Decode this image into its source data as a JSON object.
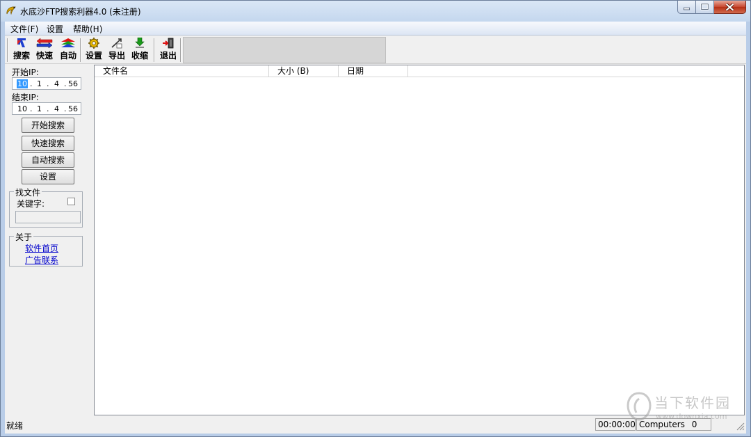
{
  "window": {
    "title": "水底沙FTP搜索利器4.0 (未注册)"
  },
  "menu": {
    "items": [
      "文件(F)",
      "设置",
      "帮助(H)"
    ]
  },
  "toolbar": {
    "search": "搜索",
    "quick": "快速",
    "auto": "自动",
    "settings": "设置",
    "export": "导出",
    "collapse": "收缩",
    "exit": "退出"
  },
  "left_panel": {
    "start_ip_label": "开始IP:",
    "start_ip": [
      "10",
      "1",
      "4",
      "56"
    ],
    "end_ip_label": "结束IP:",
    "end_ip": [
      "10",
      "1",
      "4",
      "56"
    ],
    "btn_start_search": "开始搜索",
    "btn_quick_search": "快速搜索",
    "btn_auto_search": "自动搜索",
    "btn_settings": "设置",
    "find_group_title": "找文件",
    "keyword_label": "关键字:",
    "keyword_value": "",
    "about_group_title": "关于",
    "link_home": "软件首页",
    "link_ads": "广告联系"
  },
  "list": {
    "columns": [
      "文件名",
      "大小 (B)",
      "日期"
    ],
    "rows": []
  },
  "status": {
    "text": "就绪",
    "time": "00:00:00",
    "computers_label": "Computers",
    "computers_count": "0"
  },
  "watermark": {
    "text": "当下软件园",
    "url": "www.downxia.com"
  },
  "colors": {
    "selection": "#3399ff",
    "link": "#0000cc",
    "close_button": "#c7452f"
  }
}
